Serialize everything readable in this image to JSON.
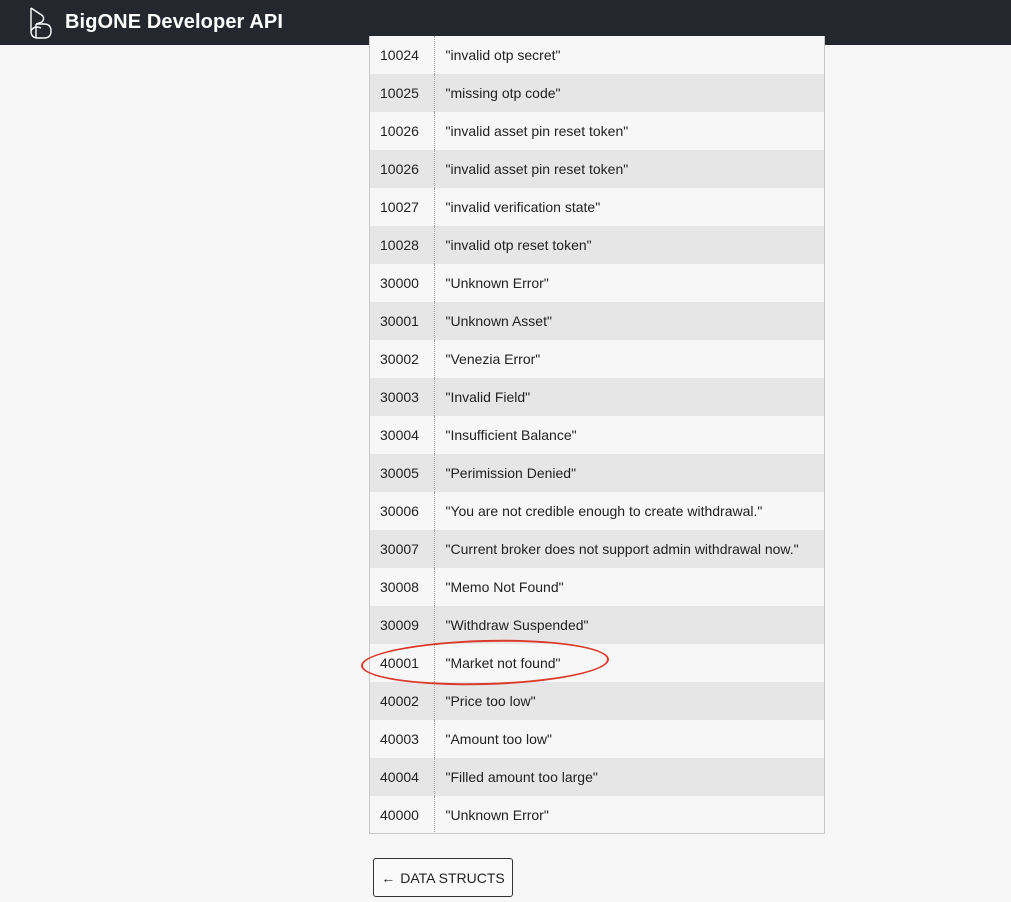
{
  "header": {
    "brand": "BigONE Developer API"
  },
  "error_table": {
    "rows": [
      {
        "code": "10024",
        "message": "\"invalid otp secret\""
      },
      {
        "code": "10025",
        "message": "\"missing otp code\""
      },
      {
        "code": "10026",
        "message": "\"invalid asset pin reset token\""
      },
      {
        "code": "10026",
        "message": "\"invalid asset pin reset token\""
      },
      {
        "code": "10027",
        "message": "\"invalid verification state\""
      },
      {
        "code": "10028",
        "message": "\"invalid otp reset token\""
      },
      {
        "code": "30000",
        "message": "\"Unknown Error\""
      },
      {
        "code": "30001",
        "message": "\"Unknown Asset\""
      },
      {
        "code": "30002",
        "message": "\"Venezia Error\""
      },
      {
        "code": "30003",
        "message": "\"Invalid Field\""
      },
      {
        "code": "30004",
        "message": "\"Insufficient Balance\""
      },
      {
        "code": "30005",
        "message": "\"Perimission Denied\""
      },
      {
        "code": "30006",
        "message": "\"You are not credible enough to create withdrawal.\""
      },
      {
        "code": "30007",
        "message": "\"Current broker does not support admin withdrawal now.\""
      },
      {
        "code": "30008",
        "message": "\"Memo Not Found\""
      },
      {
        "code": "30009",
        "message": "\"Withdraw Suspended\""
      },
      {
        "code": "40001",
        "message": "\"Market not found\""
      },
      {
        "code": "40002",
        "message": "\"Price too low\""
      },
      {
        "code": "40003",
        "message": "\"Amount too low\""
      },
      {
        "code": "40004",
        "message": "\"Filled amount too large\""
      },
      {
        "code": "40000",
        "message": "\"Unknown Error\""
      }
    ]
  },
  "pagination": {
    "prev_arrow": "←",
    "prev_label": "DATA STRUCTS"
  },
  "colors": {
    "header_bg": "#24272e",
    "row_even": "#e6e6e6",
    "row_odd": "#f7f7f7",
    "annotation_ring": "#d93a2b"
  },
  "icons": {
    "logo": "bigone-logo-icon",
    "prev": "arrow-left-icon"
  }
}
